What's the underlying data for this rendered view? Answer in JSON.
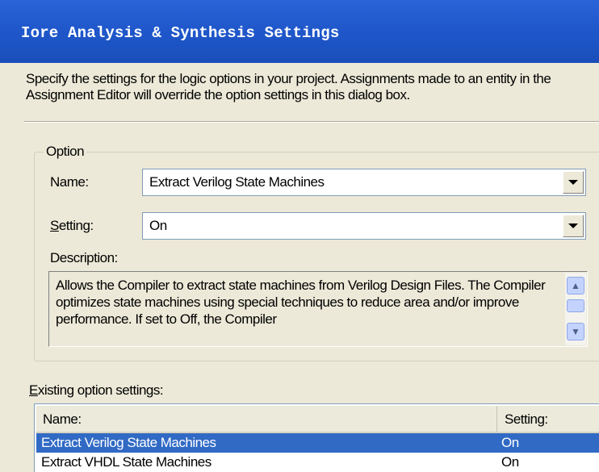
{
  "window": {
    "title": "Iore Analysis & Synthesis Settings"
  },
  "intro": {
    "text": "Specify the settings for the logic options in your project.  Assignments made to an entity in the Assignment Editor will override the option settings in this dialog box."
  },
  "option_group": {
    "label": "Option",
    "name_label": "Name:",
    "name_value": "Extract Verilog State Machines",
    "setting_label_first": "S",
    "setting_label_rest": "etting:",
    "setting_value": "On",
    "description_label": "Description:",
    "description_text": "Allows the Compiler to extract state machines from Verilog Design Files. The Compiler optimizes state machines using special techniques to reduce area and/or improve performance.  If set to Off, the Compiler"
  },
  "existing": {
    "label_first": "E",
    "label_rest": "xisting option settings:",
    "columns": [
      "Name:",
      "Setting:"
    ],
    "rows": [
      {
        "name": "Extract Verilog State Machines",
        "setting": "On",
        "selected": true
      },
      {
        "name": "Extract VHDL State Machines",
        "setting": "On",
        "selected": false
      }
    ]
  },
  "colors": {
    "title_bar": "#1e56c9",
    "selection": "#316ac5",
    "dialog_bg": "#ece9d8"
  }
}
